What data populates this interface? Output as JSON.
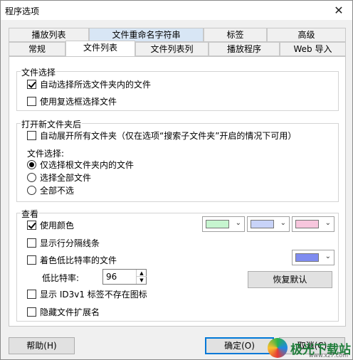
{
  "window": {
    "title": "程序选项",
    "close_glyph": "✕"
  },
  "tabs": {
    "row1": [
      "播放列表",
      "文件重命名字符串",
      "标签",
      "高级"
    ],
    "row2": [
      "常规",
      "文件列表",
      "文件列表列",
      "播放程序",
      "Web 导入"
    ]
  },
  "file_select": {
    "title": "文件选择",
    "auto_select": {
      "label": "自动选择所选文件夹内的文件",
      "checked": true
    },
    "use_checkbox": {
      "label": "使用复选框选择文件",
      "checked": false
    }
  },
  "open_folder": {
    "title": "打开新文件夹后",
    "expand_all": {
      "label": "自动展开所有文件夹（仅在选项“搜索子文件夹”开启的情况下可用）",
      "checked": false
    },
    "file_select_label": "文件选择:",
    "radios": [
      {
        "label": "仅选择根文件夹内的文件",
        "checked": true
      },
      {
        "label": "选择全部文件",
        "checked": false
      },
      {
        "label": "全部不选",
        "checked": false
      }
    ]
  },
  "view": {
    "title": "查看",
    "use_color": {
      "label": "使用颜色",
      "checked": true
    },
    "row_lines": {
      "label": "显示行分隔线条",
      "checked": false
    },
    "low_bitrate": {
      "label": "着色低比特率的文件",
      "checked": false
    },
    "bitrate_label": "低比特率:",
    "bitrate_value": "96",
    "restore_label": "恢复默认",
    "show_id3": {
      "label": "显示 ID3v1 标签不存在图标",
      "checked": false
    },
    "hide_ext": {
      "label": "隐藏文件扩展名",
      "checked": false
    },
    "colors": [
      "#c6f5cf",
      "#c8d3f8",
      "#f7c6dd"
    ],
    "low_bitrate_color": "#7f8cf0"
  },
  "buttons": {
    "help": "帮助(H)",
    "ok": "确定(O)",
    "cancel": "取消(C)"
  },
  "watermark": {
    "text": "极光下载站",
    "sub": "www.xz7.com"
  }
}
